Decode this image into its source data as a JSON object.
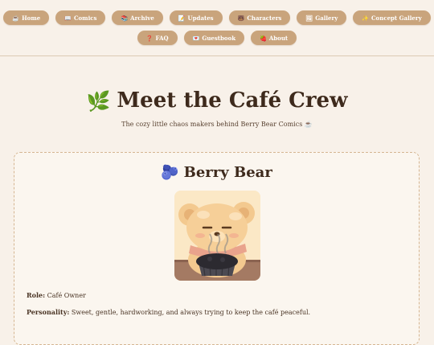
{
  "nav": {
    "row1": [
      {
        "icon": "☕",
        "icon_name": "coffee-icon",
        "label": "Home"
      },
      {
        "icon": "📖",
        "icon_name": "book-icon",
        "label": "Comics"
      },
      {
        "icon": "📚",
        "icon_name": "books-icon",
        "label": "Archive"
      },
      {
        "icon": "📝",
        "icon_name": "memo-icon",
        "label": "Updates"
      },
      {
        "icon": "🐻",
        "icon_name": "bear-icon",
        "label": "Characters"
      },
      {
        "icon": "🖼",
        "icon_name": "picture-icon",
        "label": "Gallery"
      },
      {
        "icon": "✨",
        "icon_name": "sparkles-icon",
        "label": "Concept Gallery"
      }
    ],
    "row2": [
      {
        "icon": "❓",
        "icon_name": "question-icon",
        "label": "FAQ"
      },
      {
        "icon": "💌",
        "icon_name": "love-letter-icon",
        "label": "Guestbook"
      },
      {
        "icon": "🍓",
        "icon_name": "strawberry-icon",
        "label": "About"
      }
    ]
  },
  "hero": {
    "icon": "🌿",
    "title": "Meet the Café Crew",
    "subtitle": "The cozy little chaos makers behind Berry Bear Comics ☕"
  },
  "character": {
    "icon": "🫐",
    "name": "Berry Bear",
    "role_label": "Role:",
    "role": "Café Owner",
    "personality_label": "Personality:",
    "personality": "Sweet, gentle, hardworking, and always trying to keep the café peaceful."
  },
  "colors": {
    "page_bg": "#f8f1e9",
    "nav_button": "#c9a47c",
    "card_border": "#d5b591",
    "title_text": "#3e2a1c"
  }
}
